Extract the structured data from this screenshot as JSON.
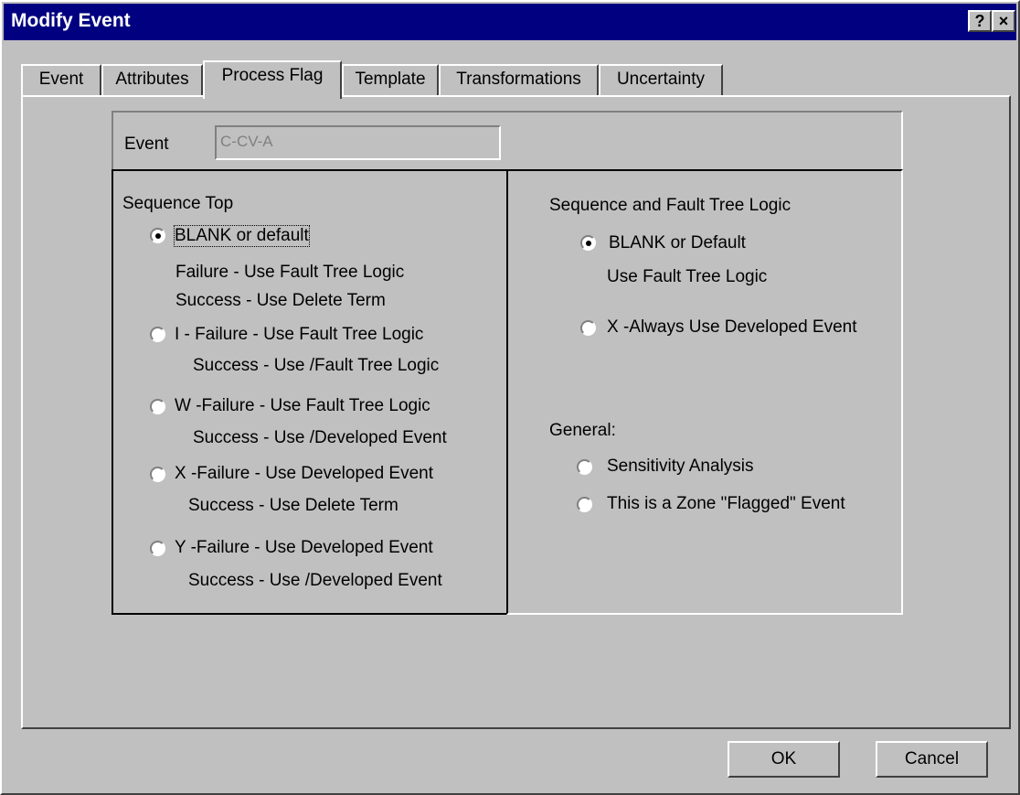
{
  "window": {
    "title": "Modify Event",
    "help_label": "?",
    "close_label": "×"
  },
  "tabs": [
    {
      "label": "Event"
    },
    {
      "label": "Attributes"
    },
    {
      "label": "Process Flag"
    },
    {
      "label": "Template"
    },
    {
      "label": "Transformations"
    },
    {
      "label": "Uncertainty"
    }
  ],
  "active_tab": "Process Flag",
  "event": {
    "label": "Event",
    "value": "C-CV-A"
  },
  "sequence_top": {
    "heading": "Sequence Top",
    "options": [
      {
        "line1": "BLANK or default",
        "line2": "Failure   - Use Fault Tree Logic",
        "line3": "Success - Use Delete Term",
        "checked": true
      },
      {
        "line1": "I - Failure - Use Fault Tree Logic",
        "line2": "Success  - Use /Fault Tree Logic",
        "checked": false
      },
      {
        "line1": "W -Failure  - Use Fault Tree Logic",
        "line2": "Success - Use /Developed Event",
        "checked": false
      },
      {
        "line1": "X -Failure - Use Developed Event",
        "line2": "Success - Use Delete Term",
        "checked": false
      },
      {
        "line1": "Y -Failure - Use Developed Event",
        "line2": "Success - Use /Developed Event",
        "checked": false
      }
    ]
  },
  "logic": {
    "heading": "Sequence and Fault Tree Logic",
    "options": [
      {
        "line1": "BLANK or Default",
        "line2": "Use Fault Tree Logic",
        "checked": true
      },
      {
        "line1": "X -Always Use Developed Event",
        "checked": false
      }
    ]
  },
  "general": {
    "heading": "General:",
    "options": [
      {
        "label": "Sensitivity Analysis",
        "checked": false
      },
      {
        "label": "This is a Zone \"Flagged\" Event",
        "checked": false
      }
    ]
  },
  "buttons": {
    "ok": "OK",
    "cancel": "Cancel"
  }
}
